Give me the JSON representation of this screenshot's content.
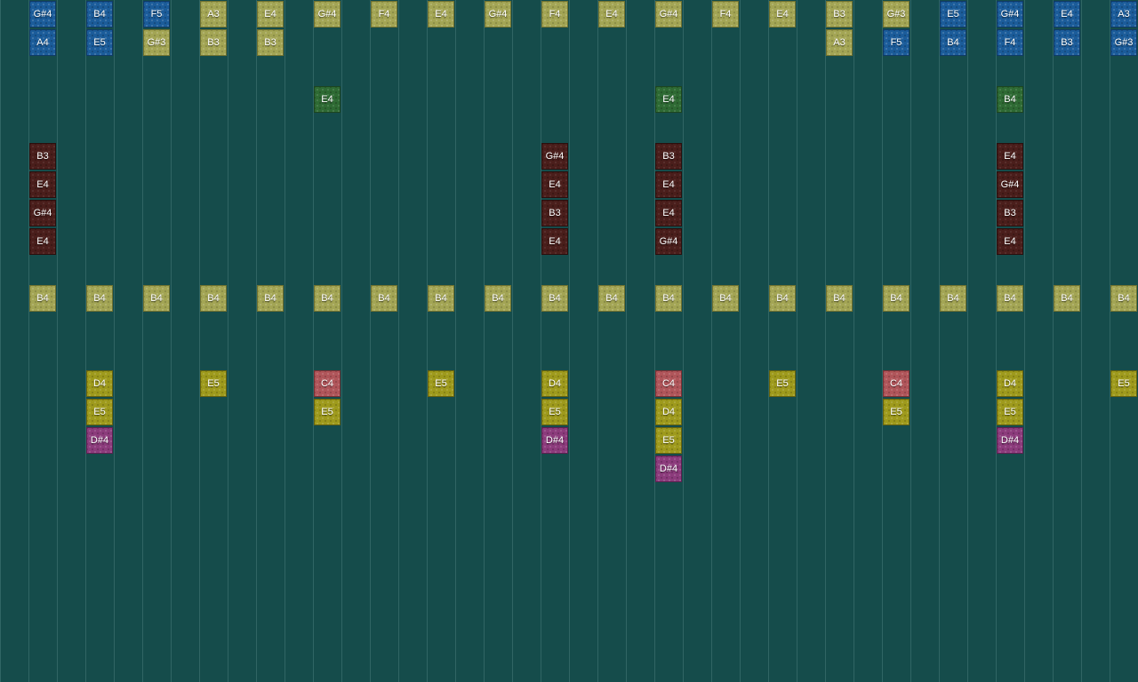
{
  "palette": {
    "background": "#154c4b",
    "blue": "#1b5c9a",
    "khaki": "#a3a554",
    "green": "#2e6a33",
    "maroon": "#4a1e1b",
    "olive": "#9e9a1c",
    "rose": "#b0555a",
    "magenta": "#8c3b7c"
  },
  "grid": {
    "columns": [
      {
        "notes": [
          {
            "row": 0,
            "label": "G#4",
            "color": "blue"
          },
          {
            "row": 1,
            "label": "A4",
            "color": "blue"
          },
          {
            "row": 5,
            "label": "B3",
            "color": "maroon"
          },
          {
            "row": 6,
            "label": "E4",
            "color": "maroon"
          },
          {
            "row": 7,
            "label": "G#4",
            "color": "maroon"
          },
          {
            "row": 8,
            "label": "E4",
            "color": "maroon"
          },
          {
            "row": 10,
            "label": "B4",
            "color": "khaki"
          }
        ]
      },
      {
        "notes": [
          {
            "row": 0,
            "label": "B4",
            "color": "blue"
          },
          {
            "row": 1,
            "label": "E5",
            "color": "blue"
          },
          {
            "row": 10,
            "label": "B4",
            "color": "khaki"
          },
          {
            "row": 13,
            "label": "D4",
            "color": "olive"
          },
          {
            "row": 14,
            "label": "E5",
            "color": "olive"
          },
          {
            "row": 15,
            "label": "D#4",
            "color": "magenta"
          }
        ]
      },
      {
        "notes": [
          {
            "row": 0,
            "label": "F5",
            "color": "blue"
          },
          {
            "row": 1,
            "label": "G#3",
            "color": "khaki"
          },
          {
            "row": 10,
            "label": "B4",
            "color": "khaki"
          }
        ]
      },
      {
        "notes": [
          {
            "row": 0,
            "label": "A3",
            "color": "khaki"
          },
          {
            "row": 1,
            "label": "B3",
            "color": "khaki"
          },
          {
            "row": 10,
            "label": "B4",
            "color": "khaki"
          },
          {
            "row": 13,
            "label": "E5",
            "color": "olive"
          }
        ]
      },
      {
        "notes": [
          {
            "row": 0,
            "label": "E4",
            "color": "khaki"
          },
          {
            "row": 1,
            "label": "B3",
            "color": "khaki"
          },
          {
            "row": 10,
            "label": "B4",
            "color": "khaki"
          }
        ]
      },
      {
        "notes": [
          {
            "row": 0,
            "label": "G#4",
            "color": "khaki"
          },
          {
            "row": 3,
            "label": "E4",
            "color": "green"
          },
          {
            "row": 10,
            "label": "B4",
            "color": "khaki"
          },
          {
            "row": 13,
            "label": "C4",
            "color": "rose"
          },
          {
            "row": 14,
            "label": "E5",
            "color": "olive"
          }
        ]
      },
      {
        "notes": [
          {
            "row": 0,
            "label": "F4",
            "color": "khaki"
          },
          {
            "row": 10,
            "label": "B4",
            "color": "khaki"
          }
        ]
      },
      {
        "notes": [
          {
            "row": 0,
            "label": "E4",
            "color": "khaki"
          },
          {
            "row": 10,
            "label": "B4",
            "color": "khaki"
          },
          {
            "row": 13,
            "label": "E5",
            "color": "olive"
          }
        ]
      },
      {
        "notes": [
          {
            "row": 0,
            "label": "G#4",
            "color": "khaki"
          },
          {
            "row": 10,
            "label": "B4",
            "color": "khaki"
          }
        ]
      },
      {
        "notes": [
          {
            "row": 0,
            "label": "F4",
            "color": "khaki"
          },
          {
            "row": 5,
            "label": "G#4",
            "color": "maroon"
          },
          {
            "row": 6,
            "label": "E4",
            "color": "maroon"
          },
          {
            "row": 7,
            "label": "B3",
            "color": "maroon"
          },
          {
            "row": 8,
            "label": "E4",
            "color": "maroon"
          },
          {
            "row": 10,
            "label": "B4",
            "color": "khaki"
          },
          {
            "row": 13,
            "label": "D4",
            "color": "olive"
          },
          {
            "row": 14,
            "label": "E5",
            "color": "olive"
          },
          {
            "row": 15,
            "label": "D#4",
            "color": "magenta"
          }
        ]
      },
      {
        "notes": [
          {
            "row": 0,
            "label": "E4",
            "color": "khaki"
          },
          {
            "row": 10,
            "label": "B4",
            "color": "khaki"
          }
        ]
      },
      {
        "notes": [
          {
            "row": 0,
            "label": "G#4",
            "color": "khaki"
          },
          {
            "row": 3,
            "label": "E4",
            "color": "green"
          },
          {
            "row": 5,
            "label": "B3",
            "color": "maroon"
          },
          {
            "row": 6,
            "label": "E4",
            "color": "maroon"
          },
          {
            "row": 7,
            "label": "E4",
            "color": "maroon"
          },
          {
            "row": 8,
            "label": "G#4",
            "color": "maroon"
          },
          {
            "row": 10,
            "label": "B4",
            "color": "khaki"
          },
          {
            "row": 13,
            "label": "C4",
            "color": "rose"
          },
          {
            "row": 14,
            "label": "D4",
            "color": "olive"
          },
          {
            "row": 15,
            "label": "E5",
            "color": "olive"
          },
          {
            "row": 16,
            "label": "D#4",
            "color": "magenta"
          }
        ]
      },
      {
        "notes": [
          {
            "row": 0,
            "label": "F4",
            "color": "khaki"
          },
          {
            "row": 10,
            "label": "B4",
            "color": "khaki"
          }
        ]
      },
      {
        "notes": [
          {
            "row": 0,
            "label": "E4",
            "color": "khaki"
          },
          {
            "row": 10,
            "label": "B4",
            "color": "khaki"
          },
          {
            "row": 13,
            "label": "E5",
            "color": "olive"
          }
        ]
      },
      {
        "notes": [
          {
            "row": 0,
            "label": "B3",
            "color": "khaki"
          },
          {
            "row": 1,
            "label": "A3",
            "color": "khaki"
          },
          {
            "row": 10,
            "label": "B4",
            "color": "khaki"
          }
        ]
      },
      {
        "notes": [
          {
            "row": 0,
            "label": "G#3",
            "color": "khaki"
          },
          {
            "row": 1,
            "label": "F5",
            "color": "blue"
          },
          {
            "row": 10,
            "label": "B4",
            "color": "khaki"
          },
          {
            "row": 13,
            "label": "C4",
            "color": "rose"
          },
          {
            "row": 14,
            "label": "E5",
            "color": "olive"
          }
        ]
      },
      {
        "notes": [
          {
            "row": 0,
            "label": "E5",
            "color": "blue"
          },
          {
            "row": 1,
            "label": "B4",
            "color": "blue"
          },
          {
            "row": 10,
            "label": "B4",
            "color": "khaki"
          }
        ]
      },
      {
        "notes": [
          {
            "row": 0,
            "label": "G#4",
            "color": "blue"
          },
          {
            "row": 1,
            "label": "F4",
            "color": "blue"
          },
          {
            "row": 3,
            "label": "B4",
            "color": "green"
          },
          {
            "row": 5,
            "label": "E4",
            "color": "maroon"
          },
          {
            "row": 6,
            "label": "G#4",
            "color": "maroon"
          },
          {
            "row": 7,
            "label": "B3",
            "color": "maroon"
          },
          {
            "row": 8,
            "label": "E4",
            "color": "maroon"
          },
          {
            "row": 10,
            "label": "B4",
            "color": "khaki"
          },
          {
            "row": 13,
            "label": "D4",
            "color": "olive"
          },
          {
            "row": 14,
            "label": "E5",
            "color": "olive"
          },
          {
            "row": 15,
            "label": "D#4",
            "color": "magenta"
          }
        ]
      },
      {
        "notes": [
          {
            "row": 0,
            "label": "E4",
            "color": "blue"
          },
          {
            "row": 1,
            "label": "B3",
            "color": "blue"
          },
          {
            "row": 10,
            "label": "B4",
            "color": "khaki"
          }
        ]
      },
      {
        "notes": [
          {
            "row": 0,
            "label": "A3",
            "color": "blue"
          },
          {
            "row": 1,
            "label": "G#3",
            "color": "blue"
          },
          {
            "row": 10,
            "label": "B4",
            "color": "khaki"
          },
          {
            "row": 13,
            "label": "E5",
            "color": "olive"
          }
        ]
      }
    ]
  }
}
